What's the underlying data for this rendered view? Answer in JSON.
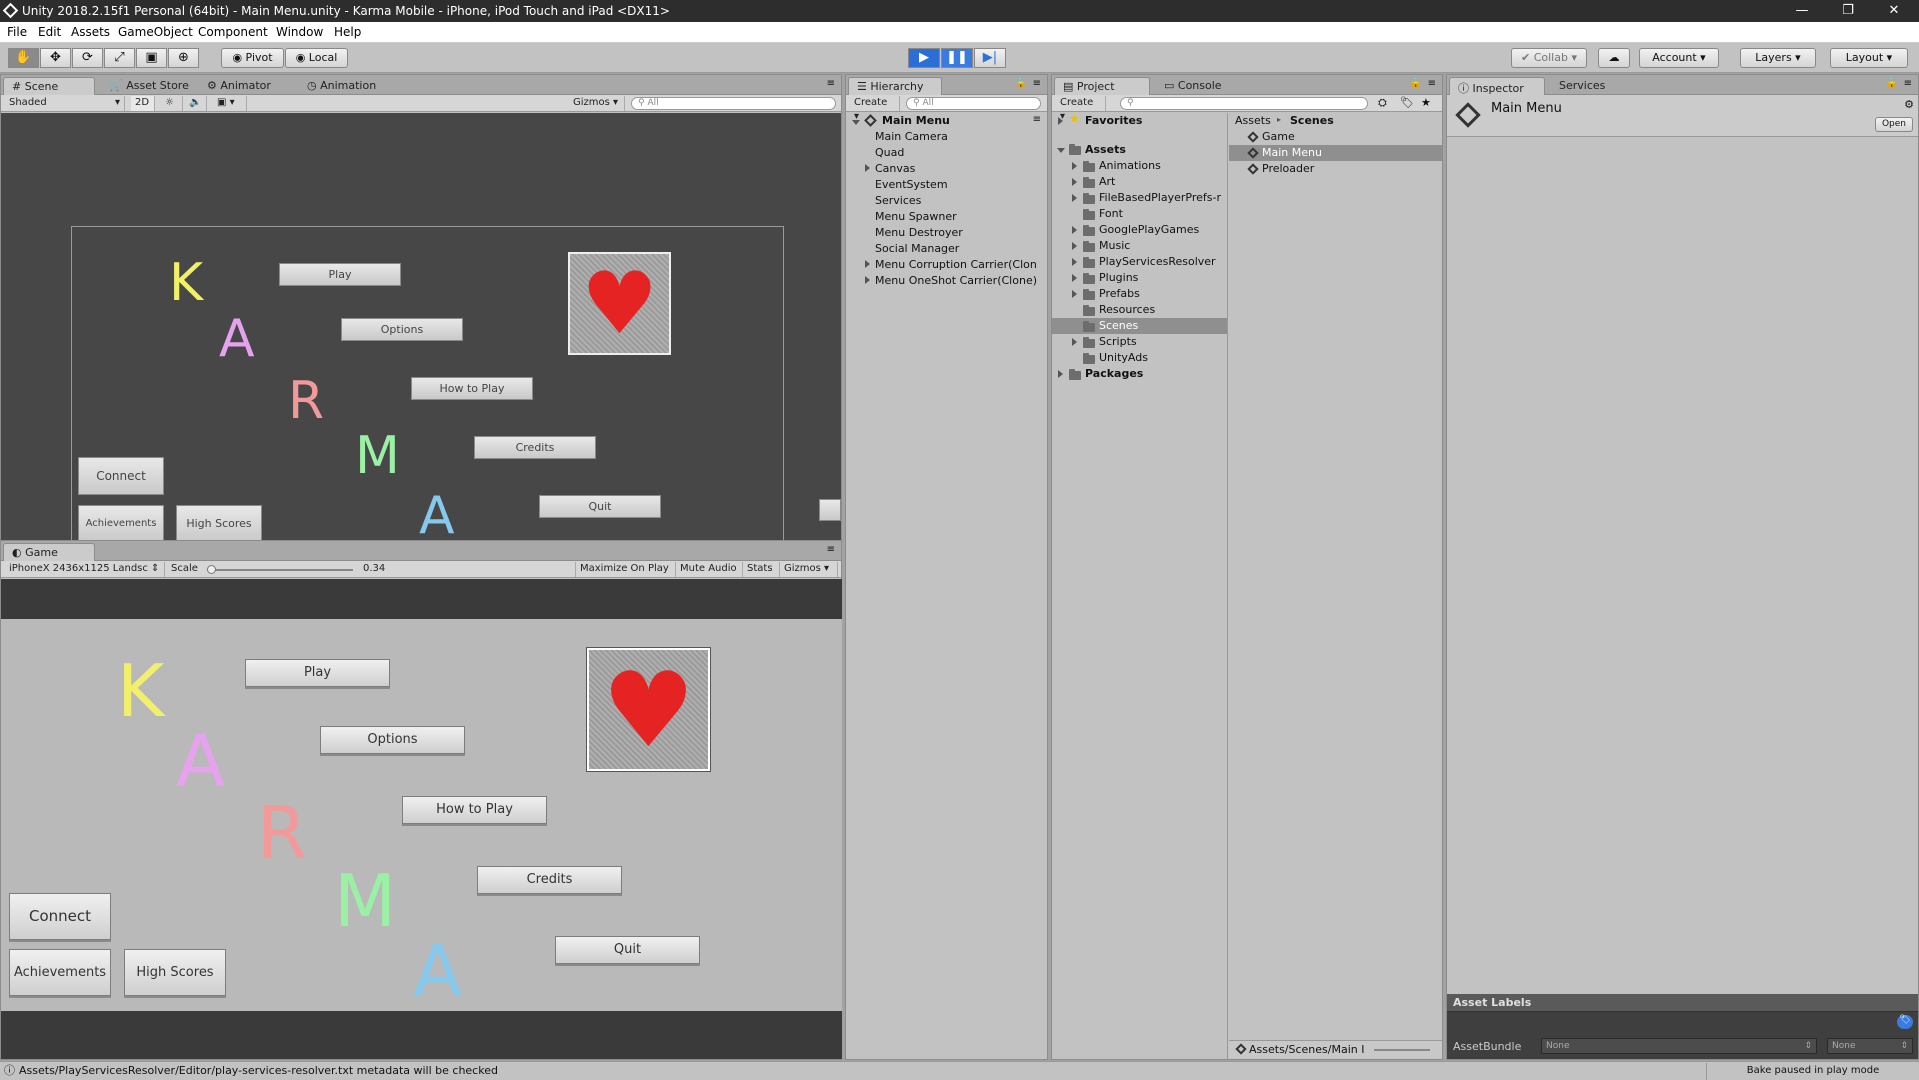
{
  "window": {
    "title": "Unity 2018.2.15f1 Personal (64bit) - Main Menu.unity - Karma Mobile - iPhone, iPod Touch and iPad <DX11>",
    "controls": [
      "—",
      "❐",
      "✕"
    ]
  },
  "menubar": {
    "items": [
      "File",
      "Edit",
      "Assets",
      "GameObject",
      "Component",
      "Window",
      "Help"
    ]
  },
  "toolbar": {
    "pivot_label": "Pivot",
    "local_label": "Local",
    "collab_label": "Collab",
    "account_label": "Account",
    "layers_label": "Layers",
    "layout_label": "Layout"
  },
  "scene_panel": {
    "tabs": [
      "Scene",
      "Asset Store",
      "Animator",
      "Animation"
    ],
    "shading": "Shaded",
    "mode_2d": "2D",
    "gizmos_label": "Gizmos",
    "search_placeholder": "All"
  },
  "scene_content": {
    "buttons": {
      "play": "Play",
      "options": "Options",
      "how_to_play": "How to Play",
      "credits": "Credits",
      "quit": "Quit",
      "connect": "Connect",
      "achievements": "Achievements",
      "high_scores": "High Scores"
    },
    "letters": [
      "K",
      "A",
      "R",
      "M",
      "A"
    ],
    "letter_colors": [
      "#f2ef6a",
      "#e7a2ee",
      "#f29a9a",
      "#9cf0a6",
      "#86c9ec"
    ]
  },
  "game_panel": {
    "tab": "Game",
    "resolution": "iPhoneX 2436x1125 Landsc",
    "scale_label": "Scale",
    "scale_value": "0.34",
    "maximize_label": "Maximize On Play",
    "mute_label": "Mute Audio",
    "stats_label": "Stats",
    "gizmos_label": "Gizmos"
  },
  "hierarchy": {
    "tab": "Hierarchy",
    "create_label": "Create",
    "search_placeholder": "All",
    "scene_name": "Main Menu",
    "items": [
      "Main Camera",
      "Quad",
      "Canvas",
      "EventSystem",
      "Services",
      "Menu Spawner",
      "Menu Destroyer",
      "Social Manager",
      "Menu Corruption Carrier(Clon",
      "Menu OneShot Carrier(Clone)"
    ]
  },
  "project": {
    "tabs": [
      "Project",
      "Console"
    ],
    "create_label": "Create",
    "favorites_label": "Favorites",
    "assets_label": "Assets",
    "folders": [
      "Animations",
      "Art",
      "FileBasedPlayerPrefs-r",
      "Font",
      "GooglePlayGames",
      "Music",
      "PlayServicesResolver",
      "Plugins",
      "Prefabs",
      "Resources",
      "Scenes",
      "Scripts",
      "UnityAds"
    ],
    "packages_label": "Packages",
    "breadcrumb_root": "Assets",
    "breadcrumb_current": "Scenes",
    "scene_files": [
      "Game",
      "Main Menu",
      "Preloader"
    ],
    "footer_path": "Assets/Scenes/Main I"
  },
  "inspector": {
    "tabs": [
      "Inspector",
      "Services"
    ],
    "object_name": "Main Menu",
    "open_label": "Open",
    "asset_labels_title": "Asset Labels",
    "asset_bundle_label": "AssetBundle",
    "bundle_value": "None",
    "variant_value": "None"
  },
  "status": {
    "message": "Assets/PlayServicesResolver/Editor/play-services-resolver.txt metadata will be checked",
    "bake_status": "Bake paused in play mode"
  }
}
